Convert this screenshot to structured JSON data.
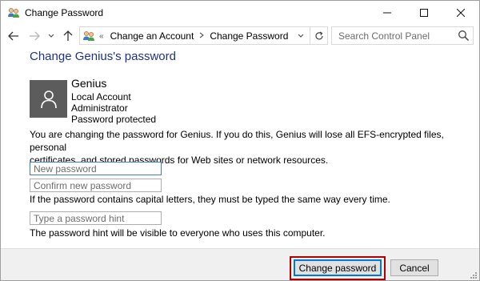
{
  "window": {
    "title": "Change Password"
  },
  "nav": {
    "breadcrumb_overflow": "«",
    "breadcrumbs": [
      "Change an Account",
      "Change Password"
    ],
    "search_placeholder": "Search Control Panel"
  },
  "page": {
    "title": "Change Genius's password",
    "user": {
      "name": "Genius",
      "lines": [
        "Local Account",
        "Administrator",
        "Password protected"
      ]
    },
    "warning_line1": "You are changing the password for Genius.  If you do this, Genius will lose all EFS-encrypted files, personal",
    "warning_line2": "certificates, and stored passwords for Web sites or network resources.",
    "fields": {
      "new_password": "New password",
      "confirm_password": "Confirm new password",
      "hint": "Type a password hint"
    },
    "case_note": "If the password contains capital letters, they must be typed the same way every time.",
    "hint_note": "The password hint will be visible to everyone who uses this computer."
  },
  "buttons": {
    "change": "Change password",
    "cancel": "Cancel"
  },
  "colors": {
    "title_blue": "#1e3287",
    "highlight_red": "#b00000",
    "avatar_gray": "#5c5c5c"
  }
}
